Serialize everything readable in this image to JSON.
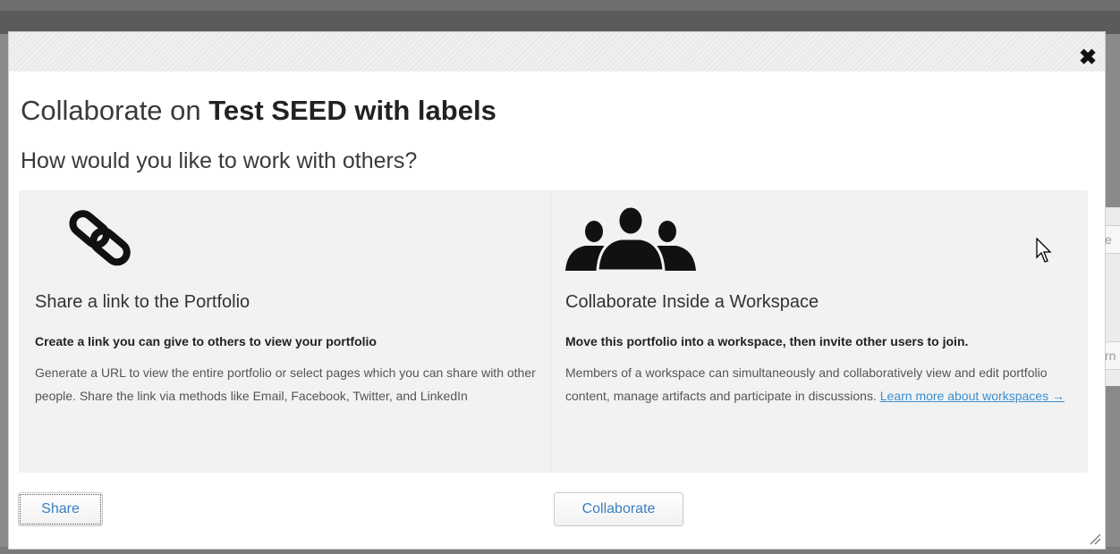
{
  "background": {
    "right_box_1": "e",
    "right_box_2": "rn"
  },
  "modal": {
    "close_symbol": "✖",
    "heading_prefix": "Collaborate on ",
    "heading_name": "Test SEED with labels",
    "subheading": "How would you like to work with others?",
    "share_panel": {
      "icon": "link-icon",
      "title": "Share a link to the Portfolio",
      "lead": "Create a link you can give to others to view your portfolio",
      "body": "Generate a URL to view the entire portfolio or select pages which you can share with other people. Share the link via methods like Email, Facebook, Twitter, and LinkedIn"
    },
    "collab_panel": {
      "icon": "group-users-icon",
      "title": "Collaborate Inside a Workspace",
      "lead": "Move this portfolio into a workspace, then invite other users to join.",
      "body": "Members of a workspace can simultaneously and collaboratively view and edit portfolio content, manage artifacts and participate in discussions. ",
      "link": "Learn more about workspaces →"
    },
    "buttons": {
      "share": "Share",
      "collaborate": "Collaborate"
    }
  },
  "colors": {
    "link": "#3a8fd1",
    "button_text": "#3a7fc0",
    "panel_bg": "#f2f2f2"
  }
}
